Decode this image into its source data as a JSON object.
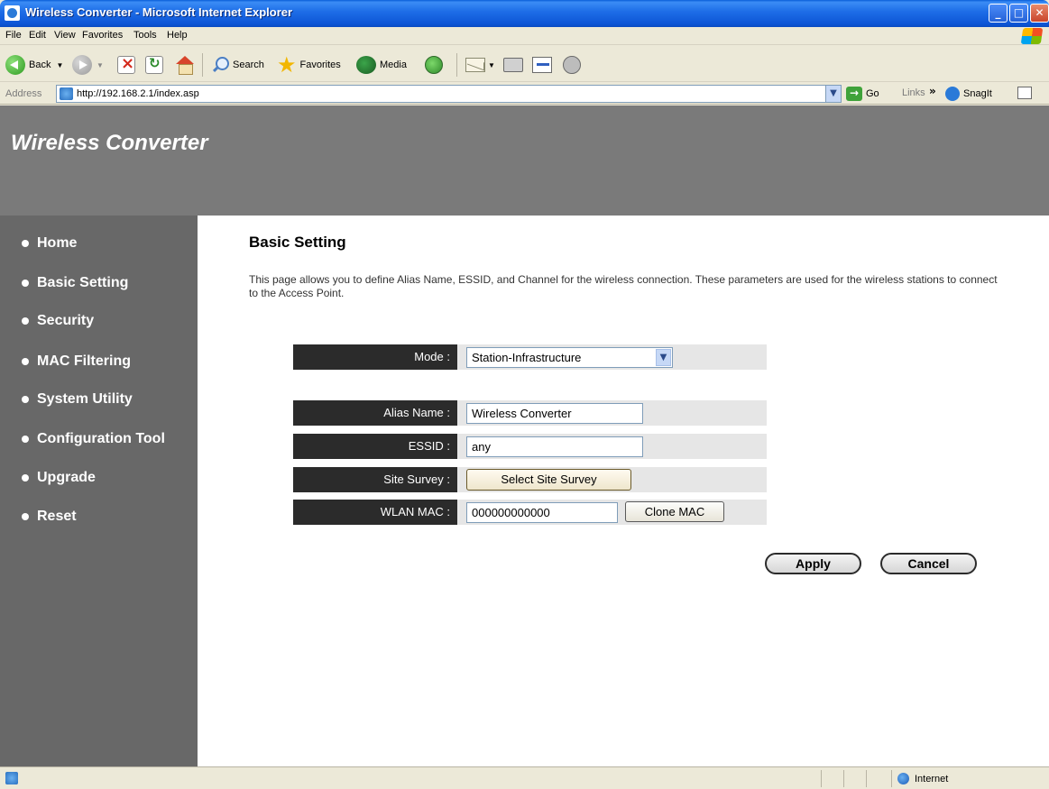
{
  "window": {
    "title": "Wireless Converter - Microsoft Internet Explorer",
    "controls": {
      "minimize": "_",
      "maximize": "□",
      "close": "✕"
    }
  },
  "menu": [
    "File",
    "Edit",
    "View",
    "Favorites",
    "Tools",
    "Help"
  ],
  "toolbar": {
    "back_label": "Back",
    "search_label": "Search",
    "favorites_label": "Favorites",
    "media_label": "Media"
  },
  "address": {
    "label": "Address",
    "url": "http://192.168.2.1/index.asp",
    "go_label": "Go",
    "links_label": "Links",
    "links_more": "»",
    "snagit_label": "SnagIt"
  },
  "header": {
    "title": "Wireless Converter"
  },
  "sidebar": {
    "items": [
      {
        "label": "Home"
      },
      {
        "label": "Basic Setting"
      },
      {
        "label": "Security"
      },
      {
        "label": "MAC Filtering"
      },
      {
        "label": "System Utility"
      },
      {
        "label": "Configuration Tool"
      },
      {
        "label": "Upgrade"
      },
      {
        "label": "Reset"
      }
    ]
  },
  "main": {
    "title": "Basic Setting",
    "description": "This page allows you to define Alias Name, ESSID, and Channel for the wireless connection. These parameters are used for the wireless stations to connect to the Access Point.",
    "mode": {
      "label": "Mode :",
      "value": "Station-Infrastructure"
    },
    "alias": {
      "label": "Alias Name :",
      "value": "Wireless Converter"
    },
    "essid": {
      "label": "ESSID :",
      "value": "any"
    },
    "site_survey": {
      "label": "Site Survey :",
      "button": "Select Site Survey"
    },
    "wlan_mac": {
      "label": "WLAN MAC :",
      "value": "000000000000",
      "button": "Clone MAC"
    },
    "apply_label": "Apply",
    "cancel_label": "Cancel"
  },
  "status": {
    "zone": "Internet"
  },
  "colors": {
    "header_bg": "#7a7a7a",
    "sidebar_bg": "#686868",
    "label_bg": "#2b2b2b",
    "row_bg": "#e6e6e6",
    "titlebar": "#1f6fe8"
  }
}
